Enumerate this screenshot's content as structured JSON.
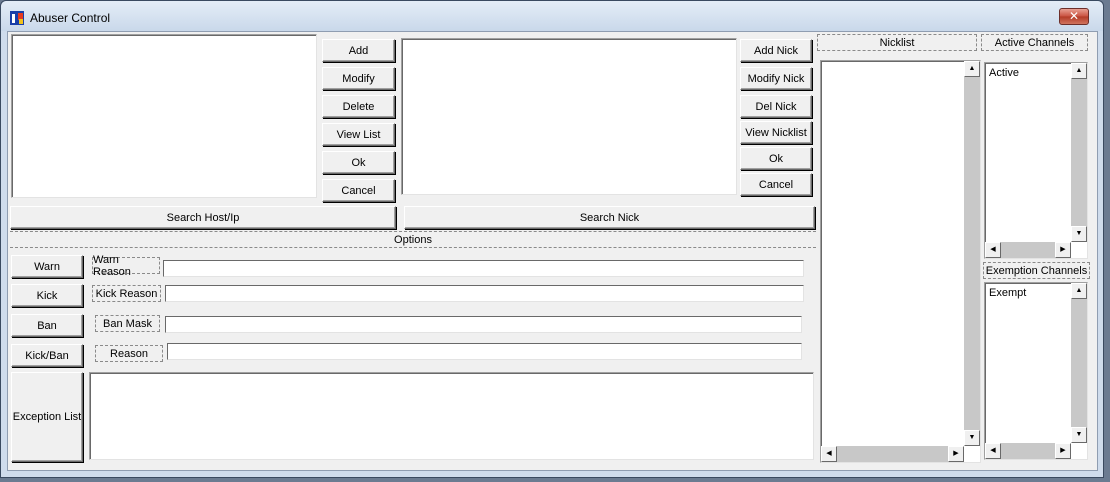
{
  "window": {
    "title": "Abuser Control",
    "close_glyph": "✕"
  },
  "host_buttons": {
    "add": "Add",
    "modify": "Modify",
    "delete": "Delete",
    "view_list": "View List",
    "ok": "Ok",
    "cancel": "Cancel"
  },
  "nick_buttons": {
    "add": "Add Nick",
    "modify": "Modify Nick",
    "delete": "Del Nick",
    "view": "View Nicklist",
    "ok": "Ok",
    "cancel": "Cancel"
  },
  "search": {
    "host": "Search Host/Ip",
    "nick": "Search Nick"
  },
  "options": {
    "header": "Options",
    "warn_button": "Warn",
    "kick_button": "Kick",
    "ban_button": "Ban",
    "kickban_button": "Kick/Ban",
    "exception_button": "Exception List",
    "warn_label": "Warn Reason",
    "kick_label": "Kick Reason",
    "ban_label": "Ban Mask",
    "reason_label": "Reason",
    "warn_value": "",
    "kick_value": "",
    "ban_value": "",
    "reason_value": ""
  },
  "nicklist": {
    "header": "Nicklist"
  },
  "channels": {
    "active_header": "Active Channels",
    "active_item": "Active",
    "exempt_header": "Exemption Channels",
    "exempt_item": "Exempt"
  },
  "scroll_glyphs": {
    "up": "▲",
    "down": "▼",
    "left": "◀",
    "right": "▶"
  },
  "colors": {
    "close_red": "#c9503e",
    "title_bg": "#cfdcec"
  }
}
